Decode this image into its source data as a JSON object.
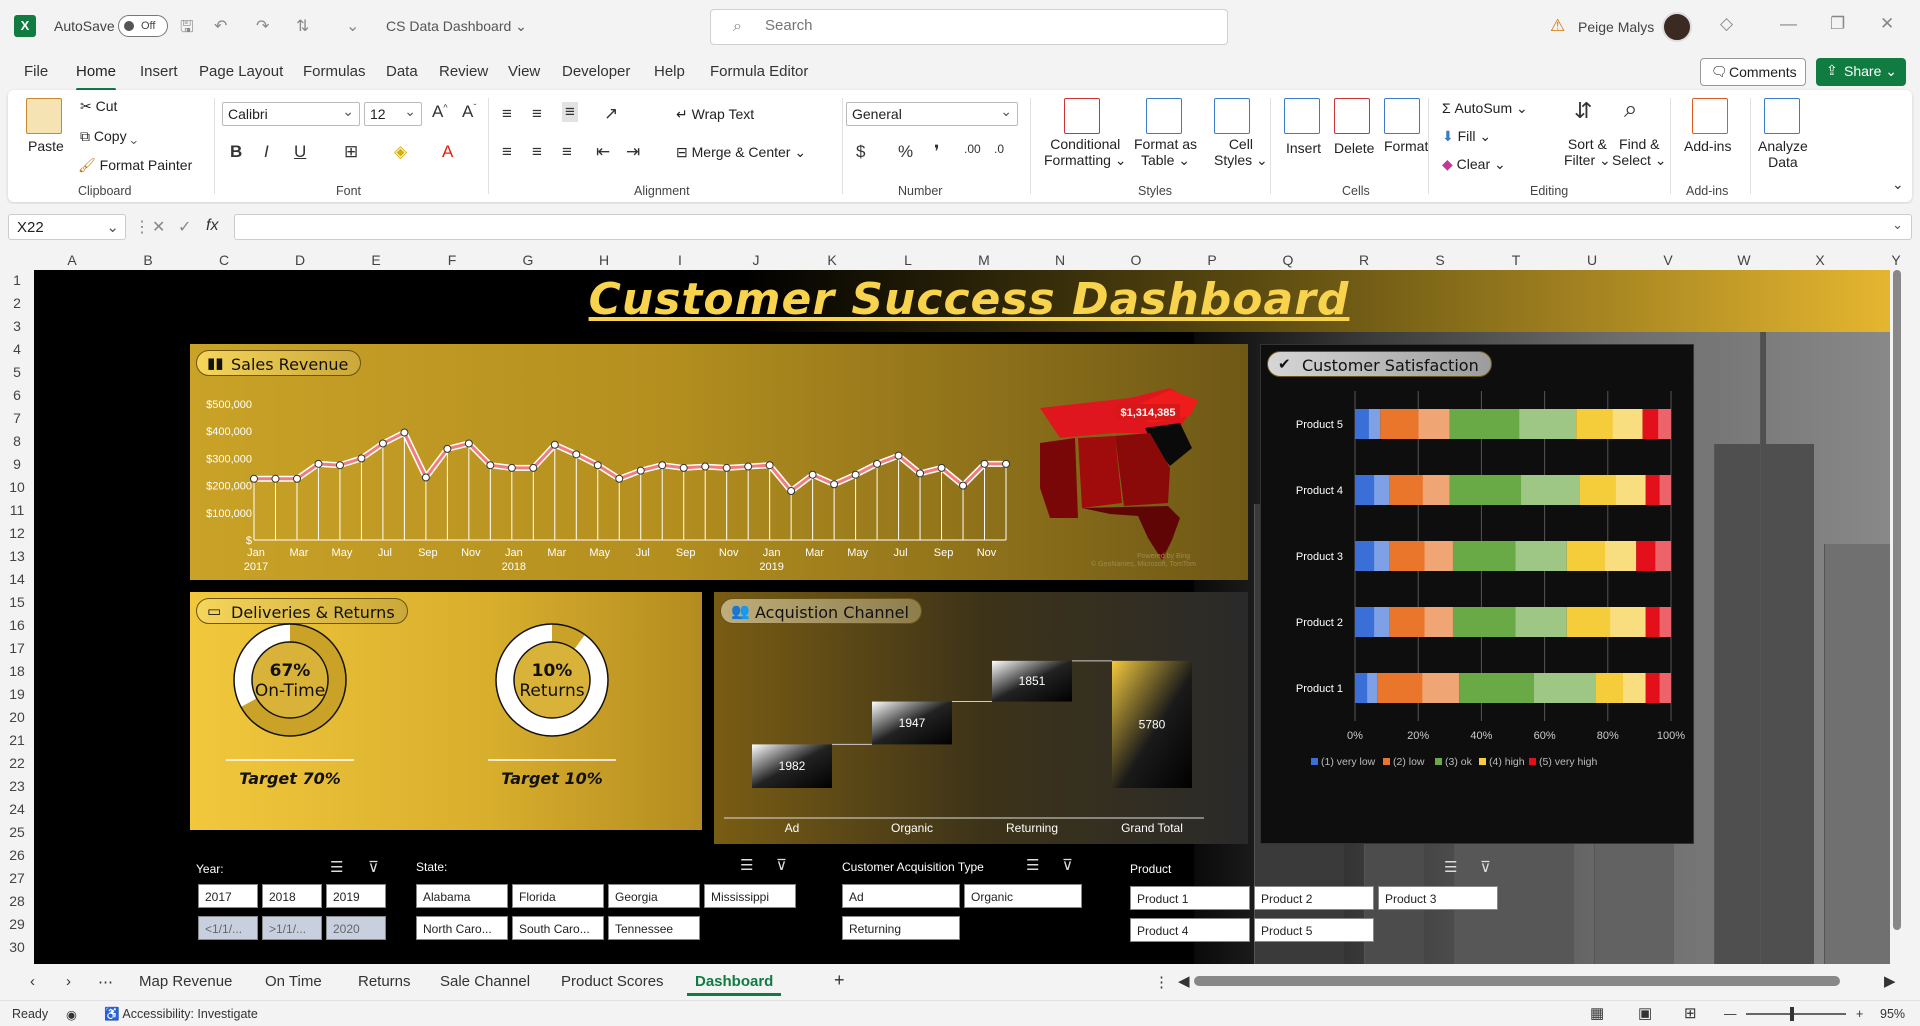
{
  "titlebar": {
    "autosave_label": "AutoSave",
    "autosave_state": "Off",
    "doc_title": "CS Data Dashboard",
    "search_placeholder": "Search",
    "user_name": "Peige Malys"
  },
  "menu": {
    "tabs": [
      "File",
      "Home",
      "Insert",
      "Page Layout",
      "Formulas",
      "Data",
      "Review",
      "View",
      "Developer",
      "Help",
      "Formula Editor"
    ],
    "active": "Home",
    "comments_label": "Comments",
    "share_label": "Share"
  },
  "ribbon": {
    "clipboard": {
      "paste": "Paste",
      "cut": "Cut",
      "copy": "Copy",
      "format_painter": "Format Painter",
      "label": "Clipboard"
    },
    "font": {
      "name": "Calibri",
      "size": "12",
      "label": "Font"
    },
    "alignment": {
      "wrap": "Wrap Text",
      "merge": "Merge & Center",
      "label": "Alignment"
    },
    "number": {
      "format": "General",
      "label": "Number"
    },
    "styles": {
      "conditional": "Conditional",
      "formatting": "Formatting",
      "format_as": "Format as",
      "table": "Table",
      "cell": "Cell",
      "styles": "Styles",
      "label": "Styles"
    },
    "cells": {
      "insert": "Insert",
      "delete": "Delete",
      "format": "Format",
      "label": "Cells"
    },
    "editing": {
      "autosum": "AutoSum",
      "fill": "Fill",
      "clear": "Clear",
      "sort": "Sort &",
      "filter": "Filter",
      "find": "Find &",
      "select": "Select",
      "label": "Editing"
    },
    "addins": {
      "addins": "Add-ins",
      "label": "Add-ins",
      "analyze": "Analyze",
      "data": "Data"
    }
  },
  "formula_bar": {
    "name_box": "X22",
    "fx": "fx",
    "formula": ""
  },
  "columns": [
    "A",
    "B",
    "C",
    "D",
    "E",
    "F",
    "G",
    "H",
    "I",
    "J",
    "K",
    "L",
    "M",
    "N",
    "O",
    "P",
    "Q",
    "R",
    "S",
    "T",
    "U",
    "V",
    "W",
    "X",
    "Y"
  ],
  "rows": [
    "1",
    "2",
    "3",
    "4",
    "5",
    "6",
    "7",
    "8",
    "9",
    "10",
    "11",
    "12",
    "13",
    "14",
    "15",
    "16",
    "17",
    "18",
    "19",
    "20",
    "21",
    "22",
    "23",
    "24",
    "25",
    "26",
    "27",
    "28",
    "29",
    "30"
  ],
  "dashboard": {
    "title": "Customer Success Dashboard",
    "sales": {
      "title": "Sales Revenue",
      "map_value": "$1,314,385",
      "map_credit_1": "Powered by Bing",
      "map_credit_2": "© GeoNames, Microsoft, TomTom"
    },
    "satisfaction": {
      "title": "Customer Satisfaction"
    },
    "deliveries": {
      "title": "Deliveries & Returns",
      "ontime_value": "67%",
      "ontime_label": "On-Time",
      "ontime_fraction": 0.67,
      "ontime_target": "Target 70%",
      "returns_value": "10%",
      "returns_label": "Returns",
      "returns_fraction": 0.1,
      "returns_target": "Target 10%"
    },
    "acquisition": {
      "title": "Acquistion Channel"
    }
  },
  "chart_data": [
    {
      "type": "line",
      "title": "Sales Revenue",
      "y_ticks": [
        "$",
        "$100,000",
        "$200,000",
        "$300,000",
        "$400,000",
        "$500,000"
      ],
      "ylim": [
        0,
        500000
      ],
      "x_tick_labels": [
        "Jan",
        "Mar",
        "May",
        "Jul",
        "Sep",
        "Nov",
        "Jan",
        "Mar",
        "May",
        "Jul",
        "Sep",
        "Nov",
        "Jan",
        "Mar",
        "May",
        "Jul",
        "Sep",
        "Nov"
      ],
      "year_labels": [
        "2017",
        "2018",
        "2019"
      ],
      "values": [
        225000,
        225000,
        225000,
        280000,
        275000,
        300000,
        355000,
        395000,
        230000,
        335000,
        355000,
        275000,
        265000,
        265000,
        350000,
        315000,
        275000,
        225000,
        255000,
        275000,
        265000,
        270000,
        265000,
        270000,
        275000,
        180000,
        240000,
        205000,
        240000,
        280000,
        310000,
        245000,
        265000,
        200000,
        280000,
        280000
      ]
    },
    {
      "type": "bar",
      "title": "Customer Satisfaction",
      "stacked": "100%",
      "categories": [
        "Product 5",
        "Product 4",
        "Product 3",
        "Product 2",
        "Product 1"
      ],
      "x_ticks": [
        "0%",
        "20%",
        "40%",
        "60%",
        "80%",
        "100%"
      ],
      "legend_position": "bottom",
      "series": [
        {
          "name": "(1) very low",
          "color": "#3a6fd8",
          "values": [
            8,
            11,
            11,
            11,
            7
          ]
        },
        {
          "name": "(2) low",
          "color": "#e9762b",
          "values": [
            22,
            19,
            20,
            20,
            26
          ]
        },
        {
          "name": "(3) ok",
          "color": "#6aaa46",
          "values": [
            40,
            41,
            36,
            36,
            43
          ]
        },
        {
          "name": "(4) high",
          "color": "#f5cc3a",
          "values": [
            21,
            21,
            22,
            25,
            16
          ]
        },
        {
          "name": "(5) very high",
          "color": "#e3101b",
          "values": [
            9,
            8,
            11,
            8,
            8
          ]
        }
      ]
    },
    {
      "type": "bar",
      "title": "Acquistion Channel",
      "subtype": "waterfall",
      "categories": [
        "Ad",
        "Organic",
        "Returning",
        "Grand Total"
      ],
      "values": [
        1982,
        1947,
        1851,
        5780
      ],
      "ylim": [
        0,
        6000
      ]
    }
  ],
  "slicers": {
    "year": {
      "title": "Year:",
      "items": [
        "2017",
        "2018",
        "2019",
        "<1/1/...",
        ">1/1/...",
        "2020"
      ]
    },
    "state": {
      "title": "State:",
      "items": [
        "Alabama",
        "Florida",
        "Georgia",
        "Mississippi",
        "North Caro...",
        "South Caro...",
        "Tennessee"
      ]
    },
    "acq": {
      "title": "Customer Acquisition Type",
      "items": [
        "Ad",
        "Organic",
        "Returning"
      ]
    },
    "product": {
      "title": "Product",
      "items": [
        "Product 1",
        "Product 2",
        "Product 3",
        "Product 4",
        "Product 5"
      ]
    }
  },
  "sheet_tabs": [
    "Map Revenue",
    "On Time",
    "Returns",
    "Sale Channel",
    "Product Scores",
    "Dashboard"
  ],
  "active_sheet": "Dashboard",
  "status": {
    "ready": "Ready",
    "accessibility": "Accessibility: Investigate",
    "zoom": "95%"
  }
}
